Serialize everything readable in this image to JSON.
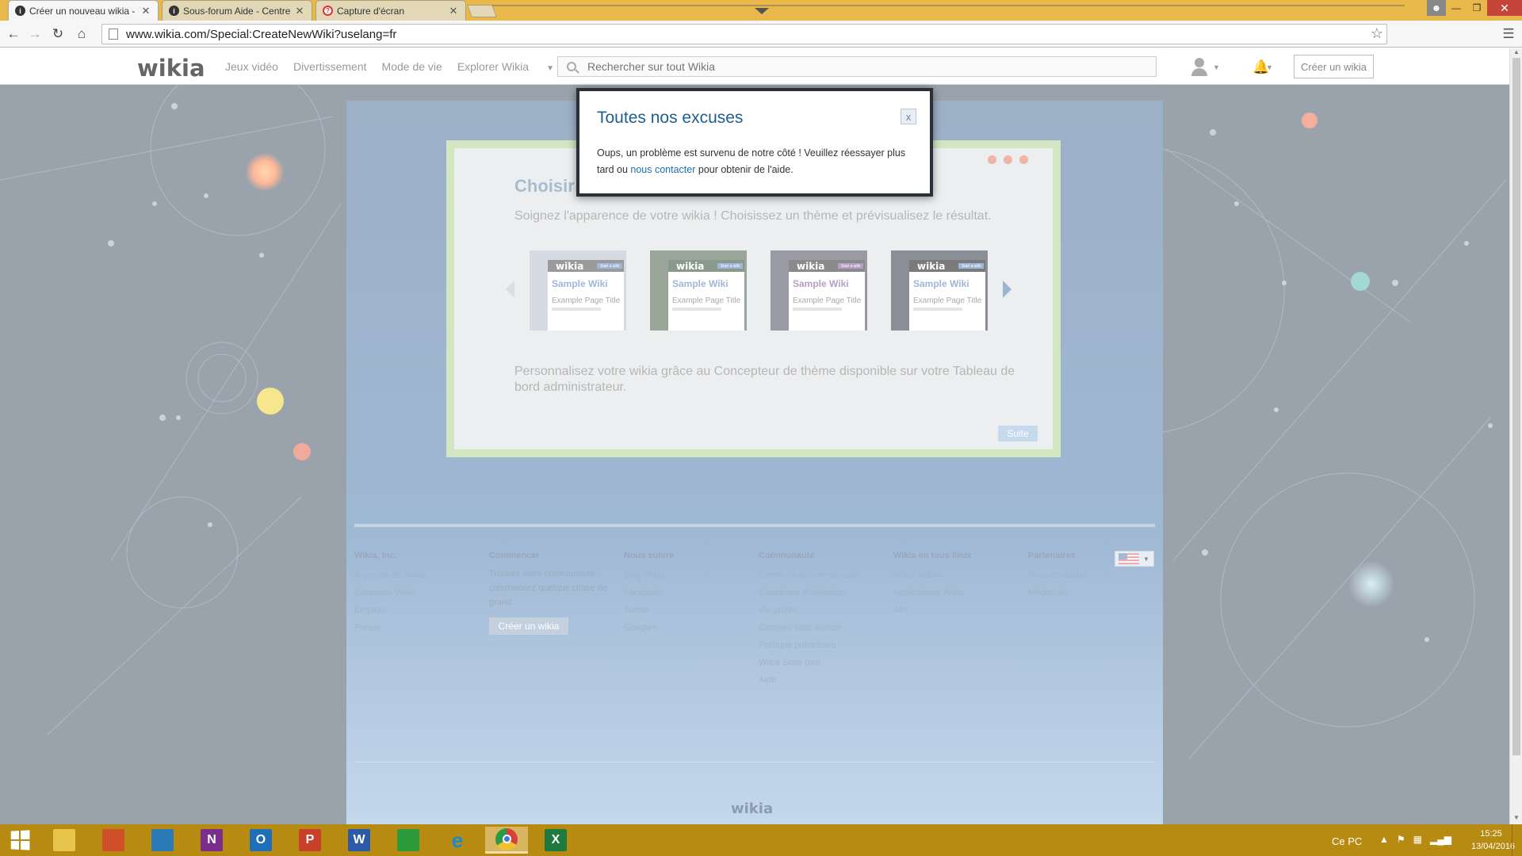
{
  "browser": {
    "tabs": [
      {
        "label": "Créer un nouveau wikia -",
        "icon": "wikia-icon",
        "active": true
      },
      {
        "label": "Sous-forum Aide - Centre",
        "icon": "wikia-icon",
        "active": false
      },
      {
        "label": "Capture d'écran",
        "icon": "help-icon",
        "active": false
      }
    ],
    "close_glyph": "✕",
    "url": "www.wikia.com/Special:CreateNewWiki?uselang=fr"
  },
  "nav": {
    "logo": "wikia",
    "links": [
      "Jeux vidéo",
      "Divertissement",
      "Mode de vie",
      "Explorer Wikia"
    ],
    "search_placeholder": "Rechercher sur tout Wikia",
    "create_button": "Créer un wikia"
  },
  "create_wiki": {
    "title": "Choisir",
    "subtitle": "Soignez l'apparence de votre wikia ! Choisissez un thème et prévisualisez le résultat.",
    "themes": [
      {
        "logo": "wikia",
        "button": "Start a wiki",
        "name": "Sample Wiki",
        "page_title": "Example Page Title",
        "accent": "#9fb6d8",
        "bar": "#9a9a9a",
        "bg": "#d6dbe3"
      },
      {
        "logo": "wikia",
        "button": "Start a wiki",
        "name": "Sample Wiki",
        "page_title": "Example Page Title",
        "accent": "#9fb6d8",
        "bar": "#8a9a8a",
        "bg": "#9aa69a"
      },
      {
        "logo": "wikia",
        "button": "Start a wiki",
        "name": "Sample Wiki",
        "page_title": "Example Page Title",
        "accent": "#b69fc6",
        "bar": "#8a8a8a",
        "bg": "#9a9aa4"
      },
      {
        "logo": "wikia",
        "button": "Start a wiki",
        "name": "Sample Wiki",
        "page_title": "Example Page Title",
        "accent": "#9fb6d8",
        "bar": "#7a7a7a",
        "bg": "#8a8e96"
      }
    ],
    "footnote": "Personnalisez votre wikia grâce au Concepteur de thème disponible sur votre Tableau de bord administrateur.",
    "next_button": "Suite"
  },
  "footer": {
    "columns": [
      {
        "heading": "Wikia, Inc.",
        "items": [
          "À propos de Wikia",
          "Contacter Wikia",
          "Emplois",
          "Presse"
        ]
      },
      {
        "heading": "Commencer",
        "text": "Trouvez votre communauté, commencez quelque chose de grand",
        "button": "Créer un wikia"
      },
      {
        "heading": "Nous suivre",
        "items": [
          "Blog Wikia",
          "Facebook",
          "Twitter",
          "Google+"
        ]
      },
      {
        "heading": "Communauté",
        "items": [
          "Centre de la communauté",
          "Conditions d'utilisation",
          "Vie privée",
          "Contenu sous licence",
          "Politique publicitaire",
          "Wikia Stats (en)",
          "Aide"
        ]
      },
      {
        "heading": "Wikia en tous lieux",
        "items": [
          "Wikia Mobile",
          "Applications Wikia",
          "API"
        ]
      },
      {
        "heading": "Partenaires",
        "items": [
          "Nous contacter",
          "Médias kit"
        ]
      }
    ],
    "logo": "wikia"
  },
  "modal": {
    "title": "Toutes nos excuses",
    "close": "x",
    "text_before": "Oups, un problème est survenu de notre côté ! Veuillez réessayer plus tard ou ",
    "link": "nous contacter",
    "text_after": " pour obtenir de l'aide."
  },
  "taskbar": {
    "apps": [
      {
        "name": "file-explorer",
        "label": "",
        "color": "#e8c44a"
      },
      {
        "name": "paint",
        "label": "",
        "color": "#d0502a"
      },
      {
        "name": "publisher",
        "label": "",
        "color": "#2a7ab8"
      },
      {
        "name": "onenote",
        "label": "N",
        "color": "#7b2f8c"
      },
      {
        "name": "outlook",
        "label": "O",
        "color": "#1e6fb8"
      },
      {
        "name": "powerpoint",
        "label": "P",
        "color": "#c8402a"
      },
      {
        "name": "word",
        "label": "W",
        "color": "#2a5aa8"
      },
      {
        "name": "store",
        "label": "",
        "color": "#2a9a3a"
      },
      {
        "name": "internet-explorer",
        "label": "e",
        "color": "#1a8ad0"
      },
      {
        "name": "chrome",
        "label": "",
        "color": "#d8403a",
        "active": true
      },
      {
        "name": "excel",
        "label": "X",
        "color": "#1e7a3e"
      }
    ],
    "tray_label": "Ce PC",
    "time": "15:25",
    "date": "13/04/2016"
  }
}
